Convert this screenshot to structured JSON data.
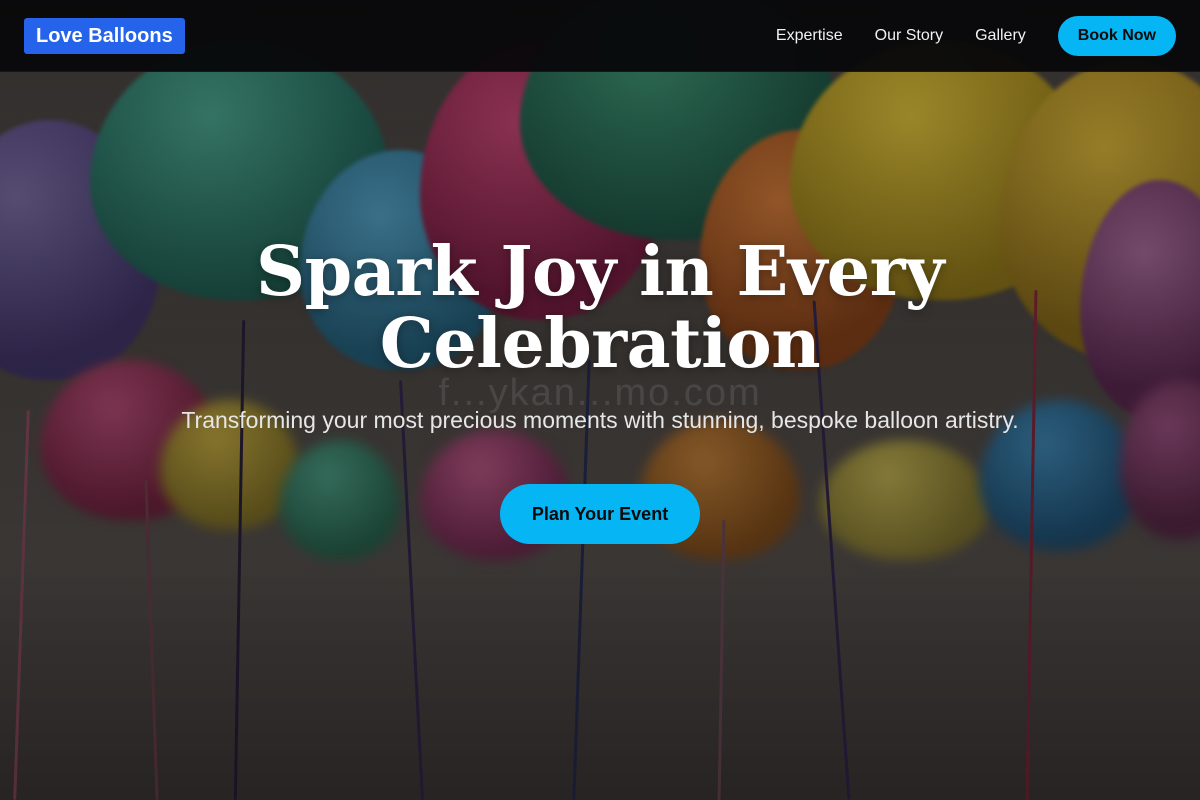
{
  "header": {
    "logo_text": "Love Balloons",
    "nav": [
      {
        "label": "Expertise"
      },
      {
        "label": "Our Story"
      },
      {
        "label": "Gallery"
      }
    ],
    "book_label": "Book Now"
  },
  "hero": {
    "title": "Spark Joy in Every Celebration",
    "subtitle": "Transforming your most precious moments with stunning, bespoke balloon artistry.",
    "cta_label": "Plan Your Event",
    "watermark": "f...ykan...mo.com"
  },
  "colors": {
    "logo_bg": "#2563eb",
    "accent": "#06b6f4",
    "header_bg": "#08080a"
  }
}
